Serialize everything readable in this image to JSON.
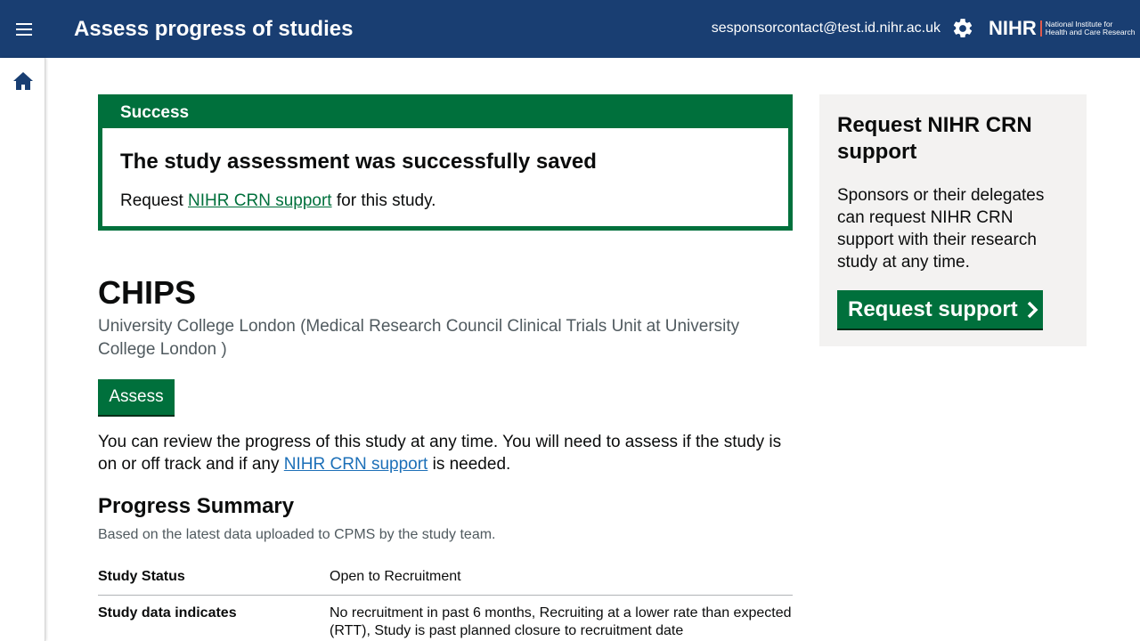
{
  "header": {
    "title": "Assess progress of studies",
    "user_email": "sesponsorcontact@test.id.nihr.ac.uk",
    "logo": {
      "mark": "NIHR",
      "line1": "National Institute for",
      "line2": "Health and Care Research"
    },
    "icons": {
      "menu": "menu-icon",
      "settings": "gear-icon",
      "home": "home-icon"
    },
    "colors": {
      "header_bg": "#193e72",
      "logo_separator": "#e05a4d"
    }
  },
  "success": {
    "heading": "Success",
    "title": "The study assessment was successfully saved",
    "body_prefix": "Request ",
    "body_link": "NIHR CRN support",
    "body_suffix": " for this study.",
    "color": "#00703c"
  },
  "study": {
    "name": "CHIPS",
    "organisation": "University College London (Medical Research Council Clinical Trials Unit at University College London )",
    "assess_label": "Assess",
    "intro_text": "You can review the progress of this study at any time. You will need to assess if the study is on or off track and if any ",
    "intro_link": "NIHR CRN support",
    "intro_suffix": " is needed."
  },
  "summary": {
    "title": "Progress Summary",
    "hint": "Based on the latest data uploaded to CPMS by the study team.",
    "rows": [
      {
        "key": "Study Status",
        "value": "Open to Recruitment"
      },
      {
        "key": "Study data indicates",
        "value": "No recruitment in past 6 months, Recruiting at a lower rate than expected (RTT), Study is past planned closure to recruitment date"
      }
    ]
  },
  "support_panel": {
    "title": "Request NIHR CRN support",
    "text": "Sponsors or their delegates can request NIHR CRN support with their research study at any time.",
    "button_label": "Request support",
    "button_icon": "chevron-right-icon"
  }
}
